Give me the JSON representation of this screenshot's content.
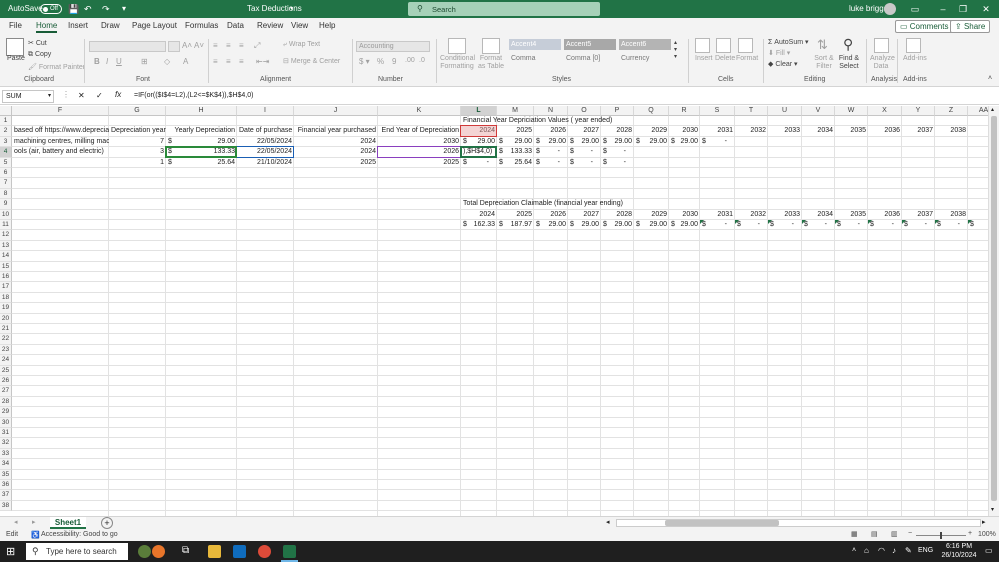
{
  "title_bar": {
    "autosave_label": "AutoSave",
    "autosave_state": "Off",
    "document_title": "Tax Deductions",
    "search_placeholder": "Search",
    "user_name": "luke briggs"
  },
  "tabs": [
    "File",
    "Home",
    "Insert",
    "Draw",
    "Page Layout",
    "Formulas",
    "Data",
    "Review",
    "View",
    "Help"
  ],
  "active_tab": "Home",
  "comments_label": "Comments",
  "share_label": "Share",
  "ribbon": {
    "clipboard": {
      "paste": "Paste",
      "cut": "Cut",
      "copy": "Copy",
      "format_painter": "Format Painter",
      "label": "Clipboard"
    },
    "font": {
      "label": "Font"
    },
    "alignment": {
      "wrap_text": "Wrap Text",
      "merge_center": "Merge & Center",
      "label": "Alignment"
    },
    "number": {
      "format": "Accounting",
      "label": "Number"
    },
    "styles": {
      "conditional": "Conditional Formatting",
      "format_as_table": "Format as Table",
      "accent4": "Accent4",
      "accent5": "Accent5",
      "accent6": "Accent6",
      "comma": "Comma",
      "comma0": "Comma [0]",
      "currency": "Currency",
      "label": "Styles"
    },
    "cells": {
      "insert": "Insert",
      "delete": "Delete",
      "format": "Format",
      "label": "Cells"
    },
    "editing": {
      "autosum": "AutoSum",
      "fill": "Fill",
      "clear": "Clear",
      "sort_filter": "Sort & Filter",
      "find_select": "Find & Select",
      "label": "Editing"
    },
    "analysis": {
      "analyze_data": "Analyze Data",
      "label": "Analysis"
    },
    "addins": {
      "addins": "Add-ins",
      "label": "Add-ins"
    }
  },
  "formula_bar": {
    "name_box": "SUM",
    "formula": "=IF(or(($I$4=L2),(L2<=$K$4)),$H$4,0)"
  },
  "columns": [
    "F",
    "G",
    "H",
    "I",
    "J",
    "K",
    "L",
    "M",
    "N",
    "O",
    "P",
    "Q",
    "R",
    "S",
    "T",
    "U",
    "V",
    "W",
    "X",
    "Y",
    "Z",
    "AA"
  ],
  "rows": [
    "1",
    "2",
    "3",
    "4",
    "5",
    "6",
    "7",
    "8",
    "9",
    "10",
    "11",
    "12",
    "13",
    "14",
    "15",
    "16",
    "17",
    "18",
    "19",
    "20",
    "21",
    "22",
    "23",
    "24",
    "25",
    "26",
    "27",
    "28",
    "29",
    "30",
    "31",
    "32",
    "33",
    "34",
    "35",
    "36",
    "37",
    "38"
  ],
  "cells": {
    "L1": "Financial Year Depriciation Values ( year ended)",
    "F2": "based off https://www.depreciation-rates...",
    "G2": "Depreciation year",
    "H2": "Yearly Depreciation",
    "I2": "Date of purchase",
    "J2": "Financial year purchased",
    "K2": "End Year of Depreciation",
    "L2": "2024",
    "M2": "2025",
    "N2": "2026",
    "O2": "2027",
    "P2": "2028",
    "Q2": "2029",
    "R2": "2030",
    "S2": "2031",
    "T2": "2032",
    "U2": "2033",
    "V2": "2034",
    "W2": "2035",
    "X2": "2036",
    "Y2": "2037",
    "Z2": "2038",
    "AA2": "2",
    "F3": "machining centres, milling mach",
    "G3": "7",
    "H3": "29.00",
    "I3": "22/05/2024",
    "J3": "2024",
    "K3": "2030",
    "L3": "29.00",
    "M3": "29.00",
    "N3": "29.00",
    "O3": "29.00",
    "P3": "29.00",
    "Q3": "29.00",
    "R3": "29.00",
    "S3": "-",
    "F4": "ools (air, battery and electric)",
    "G4": "3",
    "H4": "133.33",
    "I4": "22/05/2024",
    "J4": "2024",
    "K4": "2026",
    "L4": "),$H$4,0)",
    "M4": "133.33",
    "N4": "-",
    "O4": "-",
    "P4": "-",
    "G5": "1",
    "H5": "25.64",
    "I5": "21/10/2024",
    "J5": "2025",
    "K5": "2025",
    "L5": "-",
    "M5": "25.64",
    "N5": "-",
    "O5": "-",
    "P5": "-",
    "L9": "Total Depreciation Claimable (financial year ending)",
    "L10": "2024",
    "M10": "2025",
    "N10": "2026",
    "O10": "2027",
    "P10": "2028",
    "Q10": "2029",
    "R10": "2030",
    "S10": "2031",
    "T10": "2032",
    "U10": "2033",
    "V10": "2034",
    "W10": "2035",
    "X10": "2036",
    "Y10": "2037",
    "Z10": "2038",
    "AA10": "2",
    "L11": "162.33",
    "M11": "187.97",
    "N11": "29.00",
    "O11": "29.00",
    "P11": "29.00",
    "Q11": "29.00",
    "R11": "29.00",
    "S11": "-",
    "T11": "-",
    "U11": "-",
    "V11": "-",
    "W11": "-",
    "X11": "-",
    "Y11": "-",
    "Z11": "-",
    "AA11": "-"
  },
  "currency_symbol": "$",
  "sheet_tabs": [
    "Sheet1"
  ],
  "status": {
    "mode": "Edit",
    "accessibility": "Accessibility: Good to go",
    "zoom": "100%"
  },
  "taskbar": {
    "search_placeholder": "Type here to search",
    "language": "ENG",
    "time": "6:16 PM",
    "date": "26/10/2024"
  },
  "colors": {
    "excel_green": "#217346",
    "active_tab": "#185c37",
    "selection": "#217346"
  }
}
